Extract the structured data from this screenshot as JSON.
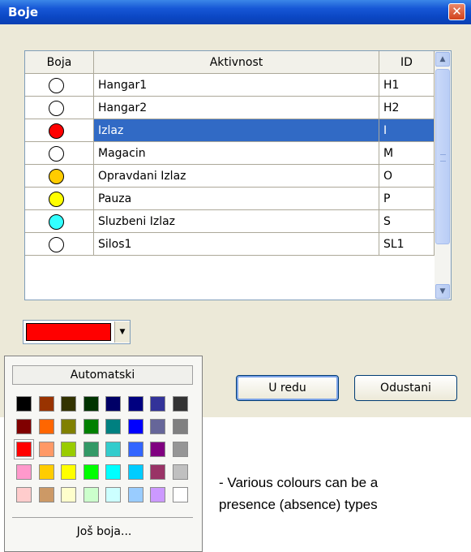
{
  "window": {
    "title": "Boje",
    "close_glyph": "✕"
  },
  "grid": {
    "columns": [
      "Boja",
      "Aktivnost",
      "ID"
    ],
    "rows": [
      {
        "color": "#ffffff",
        "activity": "Hangar1",
        "id": "H1",
        "selected": false
      },
      {
        "color": "#ffffff",
        "activity": "Hangar2",
        "id": "H2",
        "selected": false
      },
      {
        "color": "#ff0000",
        "activity": "Izlaz",
        "id": "I",
        "selected": true
      },
      {
        "color": "#ffffff",
        "activity": "Magacin",
        "id": "M",
        "selected": false
      },
      {
        "color": "#ffcc00",
        "activity": "Opravdani Izlaz",
        "id": "O",
        "selected": false
      },
      {
        "color": "#ffff00",
        "activity": "Pauza",
        "id": "P",
        "selected": false
      },
      {
        "color": "#33ffff",
        "activity": "Sluzbeni Izlaz",
        "id": "S",
        "selected": false
      },
      {
        "color": "#ffffff",
        "activity": "Silos1",
        "id": "SL1",
        "selected": false
      }
    ],
    "scroll_up_glyph": "▲",
    "scroll_down_glyph": "▼"
  },
  "color_picker": {
    "selected_color": "#ff0000",
    "arrow_glyph": "▼",
    "automatic_label": "Automatski",
    "more_colors_label": "Još boja...",
    "swatches": [
      [
        "#000000",
        "#993300",
        "#333300",
        "#003300",
        "#000066",
        "#000080",
        "#333399",
        "#333333"
      ],
      [
        "#800000",
        "#ff6600",
        "#808000",
        "#008000",
        "#008080",
        "#0000ff",
        "#666699",
        "#808080"
      ],
      [
        "#ff0000",
        "#ff9966",
        "#99cc00",
        "#339966",
        "#33cccc",
        "#3366ff",
        "#800080",
        "#969696"
      ],
      [
        "#ff99cc",
        "#ffcc00",
        "#ffff00",
        "#00ff00",
        "#00ffff",
        "#00ccff",
        "#993366",
        "#c0c0c0"
      ],
      [
        "#ffcccc",
        "#cc9966",
        "#ffffcc",
        "#ccffcc",
        "#ccffff",
        "#99ccff",
        "#cc99ff",
        "#ffffff"
      ]
    ],
    "selected_swatch": "#ff0000"
  },
  "buttons": {
    "ok": "U redu",
    "cancel": "Odustani"
  },
  "description": {
    "line1": "- Various colours can be a",
    "line2": "presence (absence) types"
  }
}
